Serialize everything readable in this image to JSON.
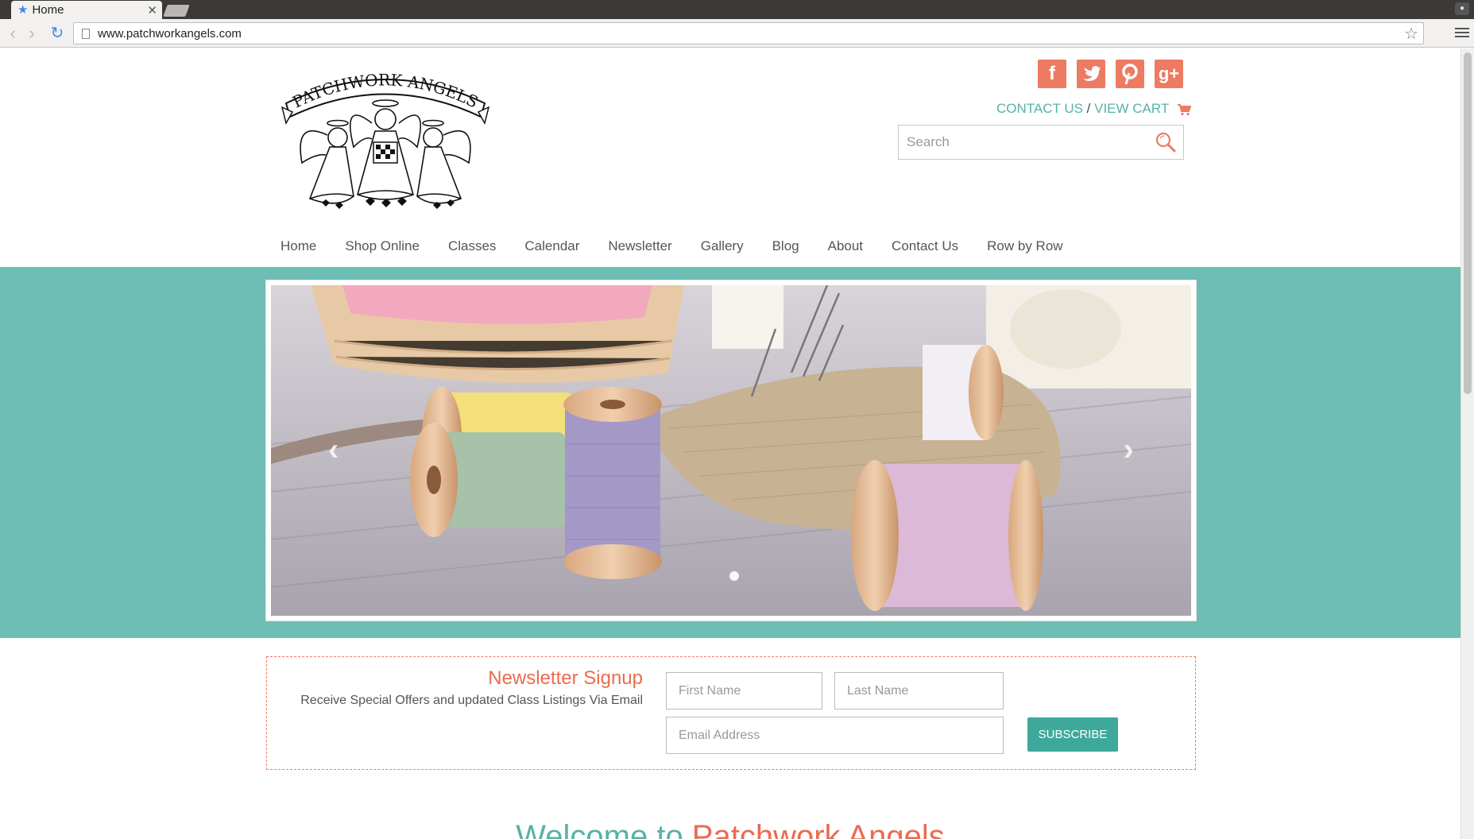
{
  "browser": {
    "tab_title": "Home",
    "url": "www.patchworkangels.com"
  },
  "header": {
    "logo_text": "PATCHWORK ANGELS",
    "social": [
      {
        "name": "facebook-icon",
        "glyph": "f"
      },
      {
        "name": "twitter-icon",
        "glyph": "t"
      },
      {
        "name": "pinterest-icon",
        "glyph": "p"
      },
      {
        "name": "google-plus-icon",
        "glyph": "g+"
      }
    ],
    "contact_link": "CONTACT US",
    "separator": " / ",
    "cart_link": "VIEW CART",
    "search_placeholder": "Search"
  },
  "nav": {
    "items": [
      "Home",
      "Shop Online",
      "Classes",
      "Calendar",
      "Newsletter",
      "Gallery",
      "Blog",
      "About",
      "Contact Us",
      "Row by Row"
    ]
  },
  "slider": {
    "prev": "‹",
    "next": "›"
  },
  "newsletter": {
    "title": "Newsletter Signup",
    "subtitle": "Receive Special Offers and updated Class Listings Via Email",
    "first_name_placeholder": "First Name",
    "last_name_placeholder": "Last Name",
    "email_placeholder": "Email Address",
    "button": "SUBSCRIBE"
  },
  "welcome": {
    "part1": "Welcome to ",
    "part2": "Patchwork Angels"
  },
  "colors": {
    "teal": "#6cbdb3",
    "coral": "#ec7b62",
    "button": "#3ea99b"
  }
}
